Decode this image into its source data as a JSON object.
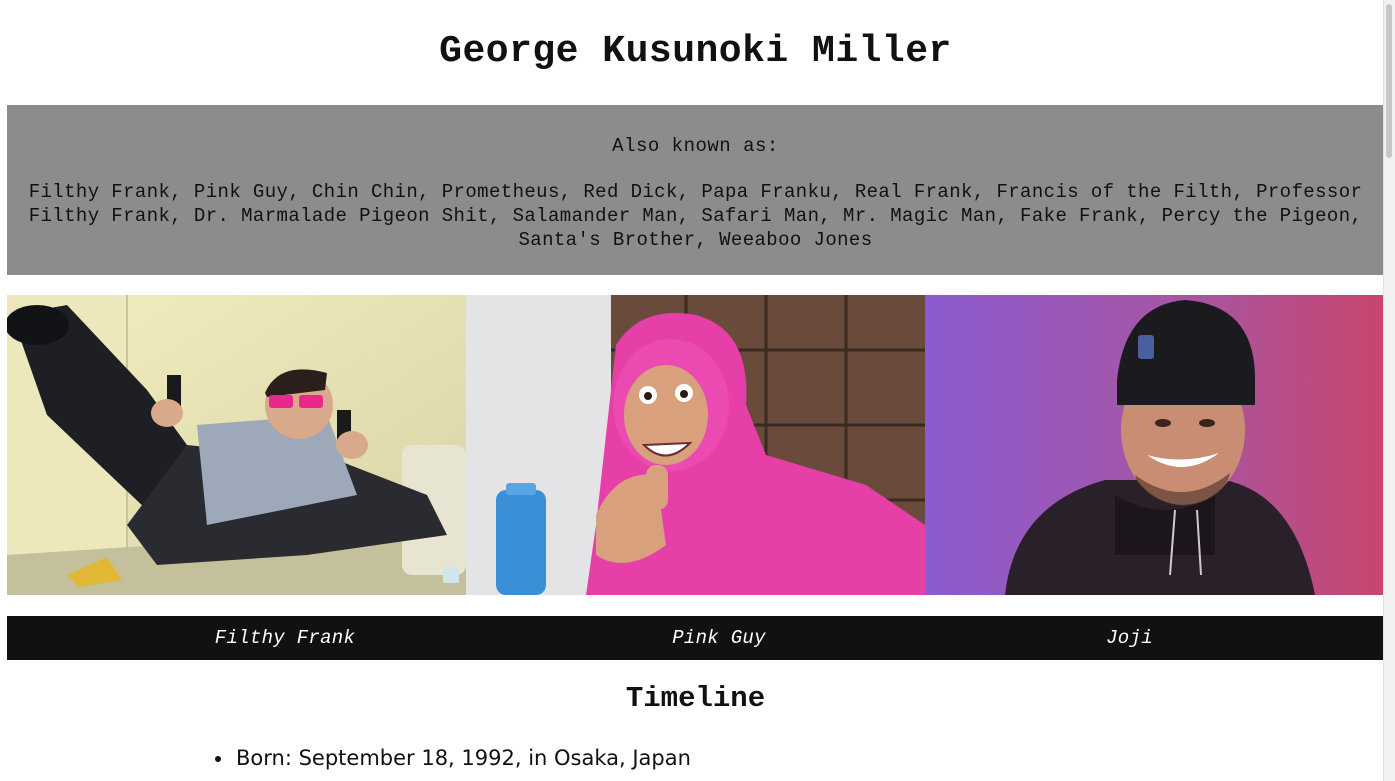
{
  "header": {
    "title": "George Kusunoki Miller"
  },
  "aka": {
    "heading": "Also known as:",
    "names": "Filthy Frank, Pink Guy, Chin Chin, Prometheus, Red Dick, Papa Franku, Real Frank, Francis of the Filth, Professor Filthy Frank, Dr. Marmalade Pigeon Shit, Salamander Man, Safari Man, Mr. Magic Man, Fake Frank, Percy the Pigeon, Santa's Brother, Weeaboo Jones"
  },
  "gallery": {
    "photos": [
      {
        "icon": "filthy-frank-photo"
      },
      {
        "icon": "pink-guy-photo"
      },
      {
        "icon": "joji-photo"
      }
    ],
    "captions": [
      "Filthy Frank",
      "Pink Guy",
      "Joji"
    ]
  },
  "timeline": {
    "title": "Timeline",
    "items": [
      "Born: September 18, 1992, in Osaka, Japan"
    ]
  },
  "colors": {
    "aka_background": "#8c8c8c",
    "caption_background": "#111111",
    "pink_suit": "#e63fa8"
  }
}
